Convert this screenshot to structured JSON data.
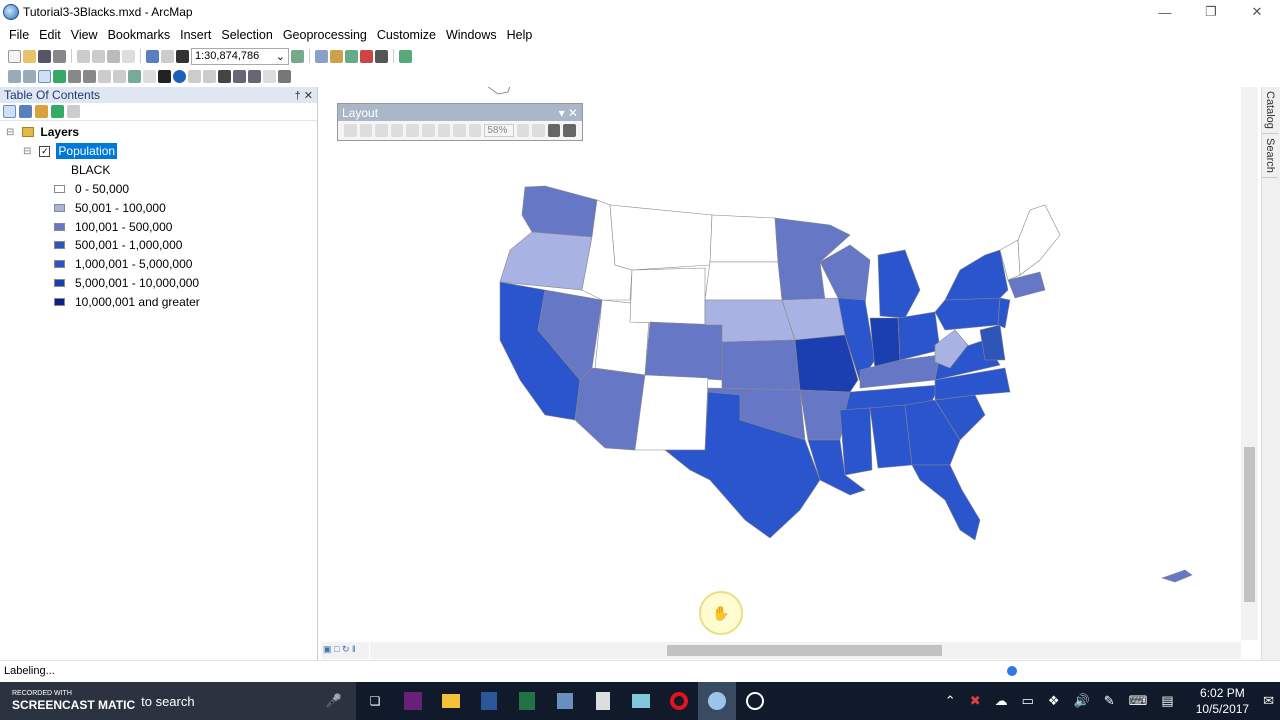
{
  "window": {
    "title": "Tutorial3-3Blacks.mxd - ArcMap"
  },
  "menu": [
    "File",
    "Edit",
    "View",
    "Bookmarks",
    "Insert",
    "Selection",
    "Geoprocessing",
    "Customize",
    "Windows",
    "Help"
  ],
  "toolbar": {
    "scale": "1:30,874,786"
  },
  "toc": {
    "title": "Table Of Contents",
    "group": "Layers",
    "layer": "Population",
    "field": "BLACK",
    "legend": [
      {
        "label": "0 - 50,000",
        "color": "#ffffff"
      },
      {
        "label": "50,001 - 100,000",
        "color": "#a9b3e3"
      },
      {
        "label": "100,001 - 500,000",
        "color": "#6678c5"
      },
      {
        "label": "500,001 - 1,000,000",
        "color": "#2f55b8"
      },
      {
        "label": "1,000,001 - 5,000,000",
        "color": "#2a55cc"
      },
      {
        "label": "5,000,001 - 10,000,000",
        "color": "#1b3fb0"
      },
      {
        "label": "10,000,001 and greater",
        "color": "#0a1e8f"
      }
    ]
  },
  "layout_toolbar": {
    "title": "Layout",
    "zoom": "58%"
  },
  "right_dock": {
    "catalog": "Catalog",
    "search": "Search"
  },
  "status": {
    "text": "Labeling..."
  },
  "taskbar": {
    "search_placeholder": "to search",
    "recorder": "RECORDED WITH",
    "recorder_brand": "SCREENCAST MATIC",
    "time": "6:02 PM",
    "date": "10/5/2017"
  },
  "colors": {
    "accent": "#0078d7",
    "selection": "#0078d7"
  }
}
